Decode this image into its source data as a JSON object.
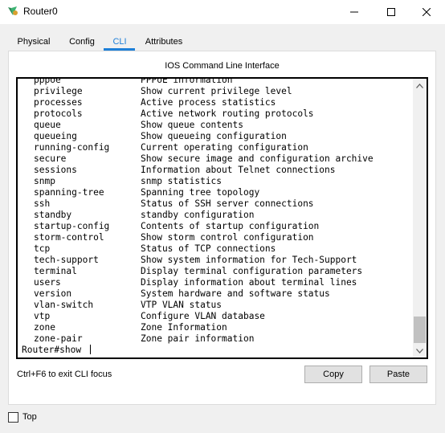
{
  "window": {
    "title": "Router0"
  },
  "tabs": [
    {
      "label": "Physical"
    },
    {
      "label": "Config"
    },
    {
      "label": "CLI"
    },
    {
      "label": "Attributes"
    }
  ],
  "section_title": "IOS Command Line Interface",
  "terminal": {
    "lines": [
      {
        "cmd": "pppoe",
        "desc": "PPPoE information"
      },
      {
        "cmd": "privilege",
        "desc": "Show current privilege level"
      },
      {
        "cmd": "processes",
        "desc": "Active process statistics"
      },
      {
        "cmd": "protocols",
        "desc": "Active network routing protocols"
      },
      {
        "cmd": "queue",
        "desc": "Show queue contents"
      },
      {
        "cmd": "queueing",
        "desc": "Show queueing configuration"
      },
      {
        "cmd": "running-config",
        "desc": "Current operating configuration"
      },
      {
        "cmd": "secure",
        "desc": "Show secure image and configuration archive"
      },
      {
        "cmd": "sessions",
        "desc": "Information about Telnet connections"
      },
      {
        "cmd": "snmp",
        "desc": "snmp statistics"
      },
      {
        "cmd": "spanning-tree",
        "desc": "Spanning tree topology"
      },
      {
        "cmd": "ssh",
        "desc": "Status of SSH server connections"
      },
      {
        "cmd": "standby",
        "desc": "standby configuration"
      },
      {
        "cmd": "startup-config",
        "desc": "Contents of startup configuration"
      },
      {
        "cmd": "storm-control",
        "desc": "Show storm control configuration"
      },
      {
        "cmd": "tcp",
        "desc": "Status of TCP connections"
      },
      {
        "cmd": "tech-support",
        "desc": "Show system information for Tech-Support"
      },
      {
        "cmd": "terminal",
        "desc": "Display terminal configuration parameters"
      },
      {
        "cmd": "users",
        "desc": "Display information about terminal lines"
      },
      {
        "cmd": "version",
        "desc": "System hardware and software status"
      },
      {
        "cmd": "vlan-switch",
        "desc": "VTP VLAN status"
      },
      {
        "cmd": "vtp",
        "desc": "Configure VLAN database"
      },
      {
        "cmd": "zone",
        "desc": "Zone Information"
      },
      {
        "cmd": "zone-pair",
        "desc": "Zone pair information"
      }
    ],
    "prompt": "Router#show "
  },
  "footer": {
    "hint": "Ctrl+F6 to exit CLI focus",
    "copy_label": "Copy",
    "paste_label": "Paste"
  },
  "top_option": {
    "label": "Top",
    "checked": false
  },
  "colors": {
    "accent": "#1e7fd8"
  }
}
